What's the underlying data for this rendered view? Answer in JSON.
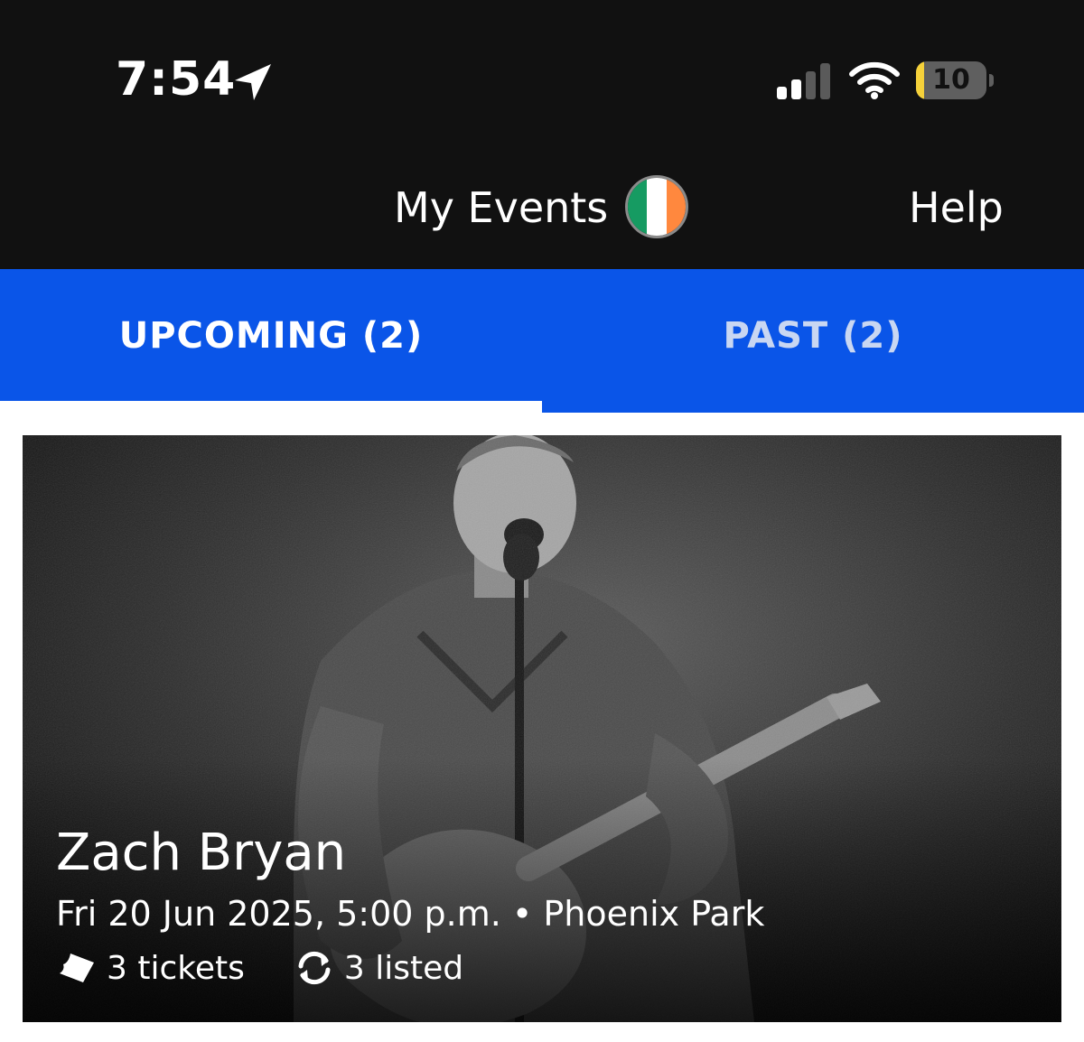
{
  "status_bar": {
    "time": "7:54",
    "location_icon": "location-arrow-icon",
    "signal_icon": "cellular-signal-icon",
    "wifi_icon": "wifi-icon",
    "battery_level": "10",
    "battery_fraction": 0.12
  },
  "header": {
    "title": "My Events",
    "flag_icon": "ireland-flag-icon",
    "flag_colors": [
      "#169b62",
      "#ffffff",
      "#ff883e"
    ],
    "help_label": "Help"
  },
  "tabs": [
    {
      "label": "UPCOMING (2)",
      "selected": true
    },
    {
      "label": "PAST (2)",
      "selected": false
    }
  ],
  "colors": {
    "tab_bar": "#0a55e8",
    "header_bg": "#111111"
  },
  "event": {
    "name": "Zach Bryan",
    "info": "Fri 20 Jun 2025, 5:00 p.m. • Phoenix Park",
    "image": "performer-photo",
    "tickets_label": "3 tickets",
    "ticket_icon": "ticket-icon",
    "listed_label": "3 listed",
    "listed_icon": "resale-sync-icon"
  }
}
